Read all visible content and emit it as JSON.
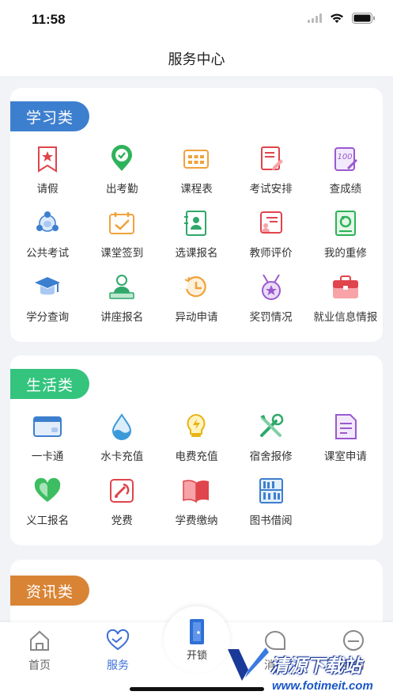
{
  "status_bar": {
    "time": "11:58"
  },
  "nav": {
    "title": "服务中心"
  },
  "sections": [
    {
      "title": "学习类",
      "color": "#3d7fcf",
      "items": [
        {
          "label": "请假",
          "icon": "leave-bookmark-icon"
        },
        {
          "label": "出考勤",
          "icon": "attendance-check-icon"
        },
        {
          "label": "课程表",
          "icon": "timetable-icon"
        },
        {
          "label": "考试安排",
          "icon": "exam-schedule-icon"
        },
        {
          "label": "查成绩",
          "icon": "grades-icon"
        },
        {
          "label": "公共考试",
          "icon": "public-exam-icon"
        },
        {
          "label": "课堂签到",
          "icon": "class-checkin-icon"
        },
        {
          "label": "选课报名",
          "icon": "course-enroll-icon"
        },
        {
          "label": "教师评价",
          "icon": "teacher-review-icon"
        },
        {
          "label": "我的重修",
          "icon": "retake-icon"
        },
        {
          "label": "学分查询",
          "icon": "credits-cap-icon"
        },
        {
          "label": "讲座报名",
          "icon": "lecture-icon"
        },
        {
          "label": "异动申请",
          "icon": "status-change-clock-icon"
        },
        {
          "label": "奖罚情况",
          "icon": "medal-icon"
        },
        {
          "label": "就业信息情报",
          "icon": "job-briefcase-icon"
        }
      ]
    },
    {
      "title": "生活类",
      "color": "#34c47e",
      "items": [
        {
          "label": "一卡通",
          "icon": "campus-card-icon"
        },
        {
          "label": "水卡充值",
          "icon": "water-drop-icon"
        },
        {
          "label": "电费充值",
          "icon": "lightbulb-icon"
        },
        {
          "label": "宿舍报修",
          "icon": "repair-tools-icon"
        },
        {
          "label": "课室申请",
          "icon": "classroom-doc-icon"
        },
        {
          "label": "义工报名",
          "icon": "volunteer-heart-icon"
        },
        {
          "label": "党费",
          "icon": "party-fee-icon"
        },
        {
          "label": "学费缴纳",
          "icon": "tuition-book-icon"
        },
        {
          "label": "图书借阅",
          "icon": "library-shelf-icon"
        }
      ]
    },
    {
      "title": "资讯类",
      "color": "#d98435",
      "items": []
    }
  ],
  "tab_bar": {
    "home": "首页",
    "service": "服务",
    "center": "开锁",
    "message": "消息",
    "mine": "我的"
  },
  "watermark": {
    "title": "清源下载站",
    "url": "www.fotimeit.com"
  }
}
